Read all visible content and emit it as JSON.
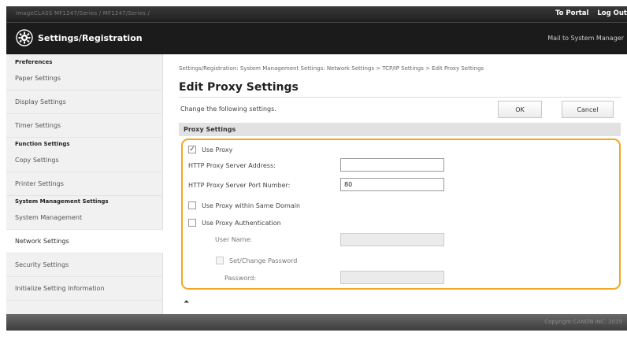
{
  "topbar": {
    "path": "ImageCLASS  MF1247/Series / MF1247/Series /",
    "to_portal": "To Portal",
    "log_out": "Log Out"
  },
  "header": {
    "title": "Settings/Registration",
    "mail": "Mail to System Manager"
  },
  "sidebar": {
    "groups": [
      "Preferences",
      "Function Settings",
      "System Management Settings"
    ],
    "items": [
      "Paper Settings",
      "Display Settings",
      "Timer Settings",
      "Copy Settings",
      "Printer Settings",
      "System Management",
      "Network Settings",
      "Security Settings",
      "Initialize Setting Information"
    ],
    "active_item": "Network Settings"
  },
  "main": {
    "breadcrumb": "Settings/Registration: System Management Settings: Network Settings > TCP/IP Settings > Edit Proxy Settings",
    "title": "Edit Proxy Settings",
    "instruction": "Change the following settings.",
    "ok_label": "OK",
    "cancel_label": "Cancel",
    "section_title": "Proxy Settings",
    "use_proxy": {
      "label": "Use Proxy",
      "checked": true,
      "mark": "✓"
    },
    "server_address": {
      "label": "HTTP Proxy Server Address:",
      "value": ""
    },
    "port_number": {
      "label": "HTTP Proxy Server Port Number:",
      "value": "80"
    },
    "same_domain": {
      "label": "Use Proxy within Same Domain",
      "checked": false
    },
    "authentication": {
      "label": "Use Proxy Authentication",
      "checked": false
    },
    "user_name": {
      "label": "User Name:",
      "value": ""
    },
    "set_password": {
      "label": "Set/Change Password",
      "checked": false
    },
    "password": {
      "label": "Password:",
      "value": ""
    },
    "collapse_icon": "collapse-up-icon",
    "collapse_glyph": "⏶"
  },
  "footer": {
    "copyright": "Copyright CANON INC. 2015"
  },
  "colors": {
    "highlight": "#f2a623",
    "header_bg": "#1b1b1b"
  }
}
